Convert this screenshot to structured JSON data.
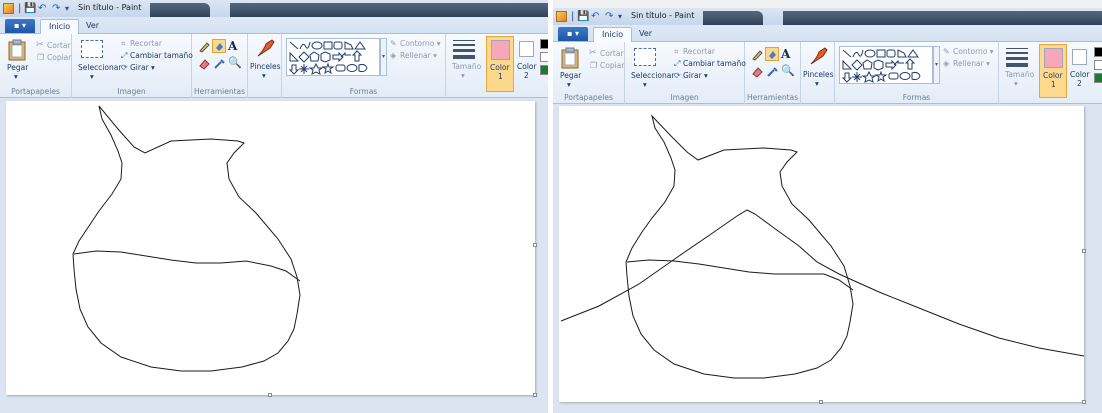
{
  "windows": [
    {
      "id": "left",
      "title": "Sin título - Paint",
      "file_tab": "▪ ▾",
      "tabs": [
        "Inicio",
        "Ver"
      ],
      "clipboard": {
        "paste": "Pegar",
        "cut": "Cortar",
        "copy": "Copiar",
        "label": "Portapapeles"
      },
      "image": {
        "select": "Seleccionar",
        "crop": "Recortar",
        "resize": "Cambiar tamaño",
        "rotate": "Girar ▾",
        "label": "Imagen"
      },
      "tools": {
        "label": "Herramientas"
      },
      "brushes": {
        "label": "Pinceles"
      },
      "shapes": {
        "outline": "Contorno ▾",
        "fill": "Rellenar ▾",
        "label": "Formas"
      },
      "size": {
        "label": "Tamaño"
      },
      "color1": {
        "label": "Color",
        "num": "1"
      },
      "color2": {
        "label": "Color",
        "num": "2"
      },
      "colors": {
        "color1": "#f7a8b8",
        "color2": "#ffffff",
        "accent": "#e7a53a"
      }
    },
    {
      "id": "right",
      "title": "Sin título - Paint",
      "file_tab": "▪ ▾",
      "tabs": [
        "Inicio",
        "Ver"
      ],
      "clipboard": {
        "paste": "Pegar",
        "cut": "Cortar",
        "copy": "Copiar",
        "label": "Portapapeles"
      },
      "image": {
        "select": "Seleccionar",
        "crop": "Recortar",
        "resize": "Cambiar tamaño",
        "rotate": "Girar ▾",
        "label": "Imagen"
      },
      "tools": {
        "label": "Herramientas"
      },
      "brushes": {
        "label": "Pinceles"
      },
      "shapes": {
        "outline": "Contorno ▾",
        "fill": "Rellenar ▾",
        "label": "Formas"
      },
      "size": {
        "label": "Tamaño"
      },
      "color1": {
        "label": "Color",
        "num": "1"
      },
      "color2": {
        "label": "Color",
        "num": "2"
      },
      "colors": {
        "color1": "#f7a8b8",
        "color2": "#ffffff",
        "accent": "#e7a53a"
      }
    }
  ]
}
